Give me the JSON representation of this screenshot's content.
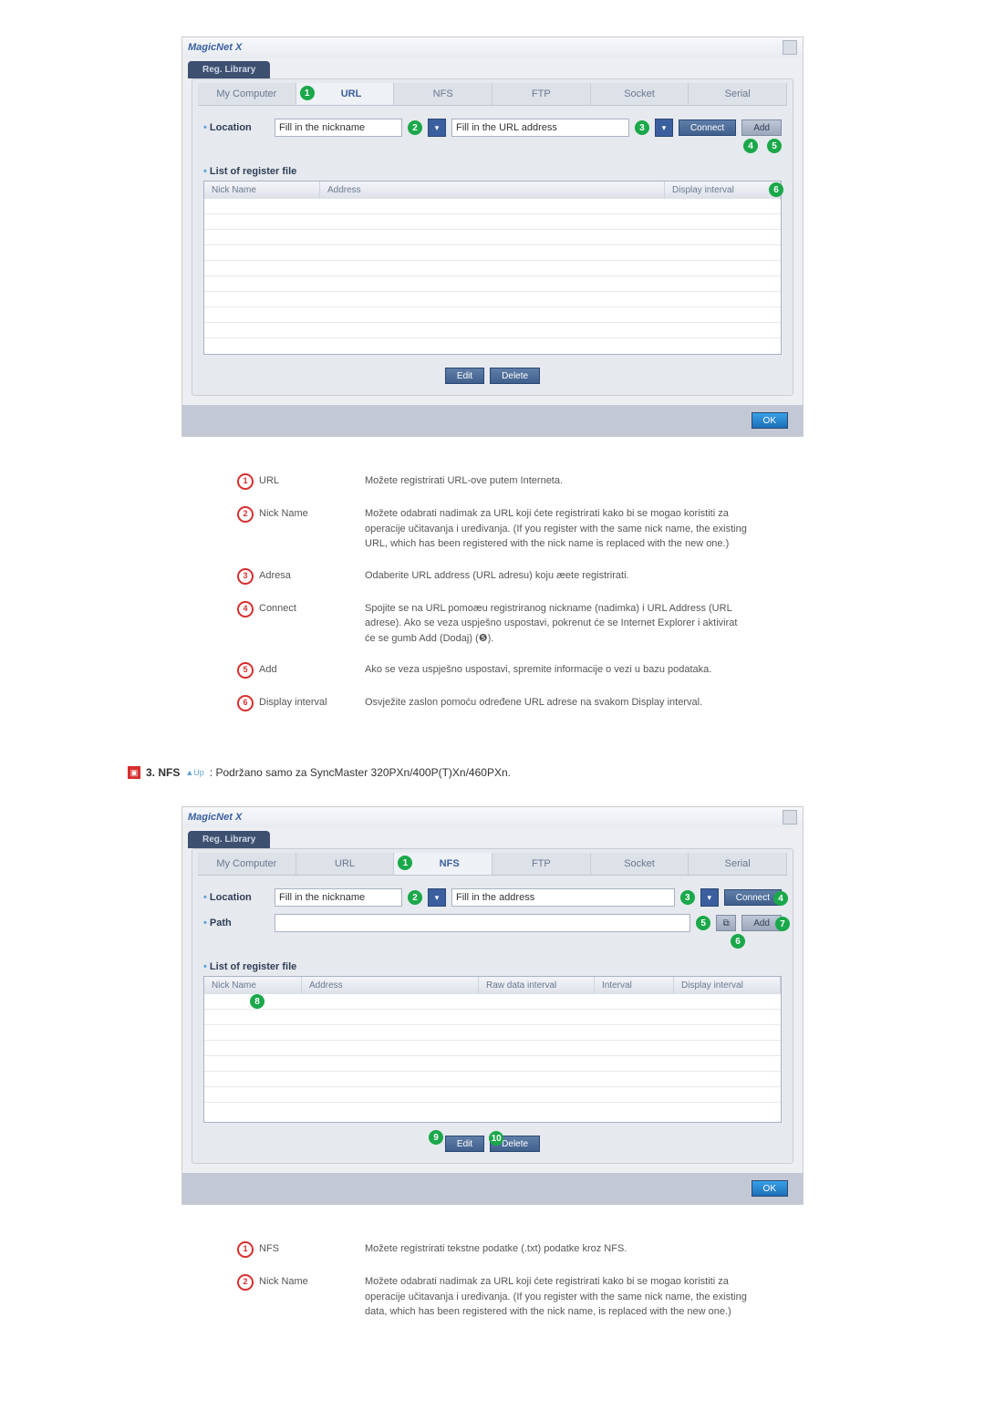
{
  "window1": {
    "title": "MagicNet X",
    "tab": "Reg. Library",
    "sourceTabs": [
      "My Computer",
      "URL",
      "NFS",
      "FTP",
      "Socket",
      "Serial"
    ],
    "activeTabIndex": 1,
    "location_label": "Location",
    "nickname_placeholder": "Fill in the nickname",
    "url_placeholder": "Fill in the URL address",
    "connect_btn": "Connect",
    "add_btn": "Add",
    "list_label": "List of register file",
    "cols": [
      "Nick Name",
      "Address",
      "Display interval"
    ],
    "edit_btn": "Edit",
    "delete_btn": "Delete",
    "ok_btn": "OK",
    "callouts": [
      "1",
      "2",
      "3",
      "4",
      "5",
      "6"
    ]
  },
  "desc1": {
    "items": [
      {
        "n": "1",
        "term": "URL",
        "text": "Možete registrirati URL-ove putem Interneta."
      },
      {
        "n": "2",
        "term": "Nick Name",
        "text": "Možete odabrati nadimak za URL koji ćete registrirati kako bi se mogao koristiti za operacije učitavanja i uređivanja. (If you register with the same nick name, the existing URL, which has been registered with the nick name is replaced with the new one.)"
      },
      {
        "n": "3",
        "term": "Adresa",
        "text": "Odaberite URL address (URL adresu) koju æete registrirati."
      },
      {
        "n": "4",
        "term": "Connect",
        "text": "Spojite se na URL pomoæu registriranog nickname (nadimka) i URL Address (URL adrese). Ako se veza uspješno uspostavi, pokrenut će se Internet Explorer i aktivirat će se gumb Add (Dodaj) (❺)."
      },
      {
        "n": "5",
        "term": "Add",
        "text": "Ako se veza uspješno uspostavi, spremite informacije o vezi u bazu podataka."
      },
      {
        "n": "6",
        "term": "Display interval",
        "text": "Osvježite zaslon pomoću određene URL adrese na svakom Display interval."
      }
    ]
  },
  "heading2": {
    "n": "3.",
    "title": "NFS",
    "up": "▲Up",
    "note": ": Podržano samo za SyncMaster 320PXn/400P(T)Xn/460PXn."
  },
  "window2": {
    "title": "MagicNet X",
    "tab": "Reg. Library",
    "sourceTabs": [
      "My Computer",
      "URL",
      "NFS",
      "FTP",
      "Socket",
      "Serial"
    ],
    "activeTabIndex": 2,
    "location_label": "Location",
    "path_label": "Path",
    "nickname_placeholder": "Fill in the nickname",
    "addr_placeholder": "Fill in the address",
    "connect_btn": "Connect",
    "add_btn": "Add",
    "list_label": "List of register file",
    "cols": [
      "Nick Name",
      "Address",
      "Raw data interval",
      "Interval",
      "Display interval"
    ],
    "edit_btn": "Edit",
    "delete_btn": "Delete",
    "ok_btn": "OK",
    "callouts": [
      "1",
      "2",
      "3",
      "4",
      "5",
      "6",
      "7",
      "8",
      "9",
      "10"
    ]
  },
  "desc2": {
    "items": [
      {
        "n": "1",
        "term": "NFS",
        "text": "Možete registrirati tekstne podatke (.txt) podatke kroz NFS."
      },
      {
        "n": "2",
        "term": "Nick Name",
        "text": "Možete odabrati nadimak za URL koji ćete registrirati kako bi se mogao koristiti za operacije učitavanja i uređivanja. (If you register with the same nick name, the existing data, which has been registered with the nick name, is replaced with the new one.)"
      }
    ]
  }
}
